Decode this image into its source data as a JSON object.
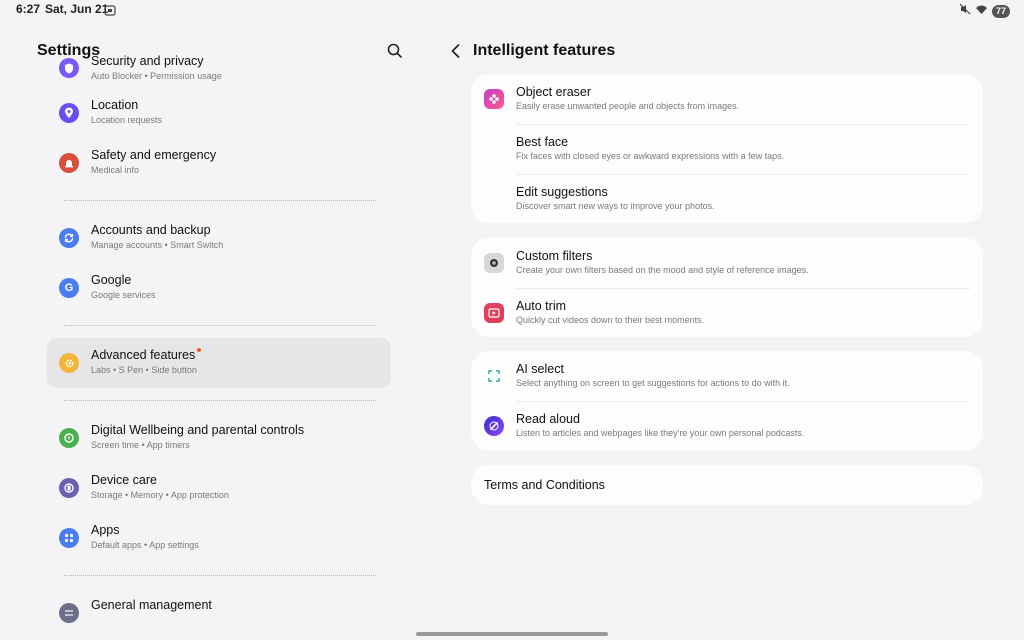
{
  "status_bar": {
    "time": "6:27",
    "date": "Sat, Jun 21",
    "battery": "77"
  },
  "left": {
    "title": "Settings",
    "items": [
      {
        "title": "Security and privacy",
        "subtitle": "Auto Blocker  •  Permission usage",
        "icon": "shield-icon",
        "color": "#7a5af5"
      },
      {
        "title": "Location",
        "subtitle": "Location requests",
        "icon": "location-pin-icon",
        "color": "#6a4df0"
      },
      {
        "title": "Safety and emergency",
        "subtitle": "Medical info",
        "icon": "siren-icon",
        "color": "#d9503f"
      },
      {
        "title": "Accounts and backup",
        "subtitle": "Manage accounts  •  Smart Switch",
        "icon": "sync-icon",
        "color": "#4a7df0"
      },
      {
        "title": "Google",
        "subtitle": "Google services",
        "icon": "google-icon",
        "color": "#4a7df0"
      },
      {
        "title": "Advanced features",
        "subtitle": "Labs  •  S Pen  •  Side button",
        "icon": "gear-plus-icon",
        "color": "#f2b53a"
      },
      {
        "title": "Digital Wellbeing and parental controls",
        "subtitle": "Screen time  •  App timers",
        "icon": "wellbeing-icon",
        "color": "#4caf50"
      },
      {
        "title": "Device care",
        "subtitle": "Storage  •  Memory  •  App protection",
        "icon": "device-care-icon",
        "color": "#6e5fb0"
      },
      {
        "title": "Apps",
        "subtitle": "Default apps  •  App settings",
        "icon": "apps-grid-icon",
        "color": "#4a7df0"
      },
      {
        "title": "General management",
        "subtitle": "",
        "icon": "sliders-icon",
        "color": "#6e6e8a"
      }
    ]
  },
  "right": {
    "title": "Intelligent features",
    "cards": [
      [
        {
          "title": "Object eraser",
          "subtitle": "Easily erase unwanted people and objects from images.",
          "icon": "object-eraser-icon",
          "color": "#c23cc9"
        },
        {
          "title": "Best face",
          "subtitle": "Fix faces with closed eyes or awkward expressions with a few taps.",
          "icon": "",
          "color": ""
        },
        {
          "title": "Edit suggestions",
          "subtitle": "Discover smart new ways to improve your photos.",
          "icon": "",
          "color": ""
        }
      ],
      [
        {
          "title": "Custom filters",
          "subtitle": "Create your own filters based on the mood and style of reference images.",
          "icon": "camera-filter-icon",
          "color": "#8f8f8f"
        },
        {
          "title": "Auto trim",
          "subtitle": "Quickly cut videos down to their best moments.",
          "icon": "video-trim-icon",
          "color": "#e0405a"
        }
      ],
      [
        {
          "title": "AI select",
          "subtitle": "Select anything on screen to get suggestions for actions to do with it.",
          "icon": "ai-select-icon",
          "color": "#2aa7a0"
        },
        {
          "title": "Read aloud",
          "subtitle": "Listen to articles and webpages like they're your own personal podcasts.",
          "icon": "read-aloud-icon",
          "color": "#5a3ce0"
        }
      ]
    ],
    "terms": "Terms and Conditions"
  }
}
